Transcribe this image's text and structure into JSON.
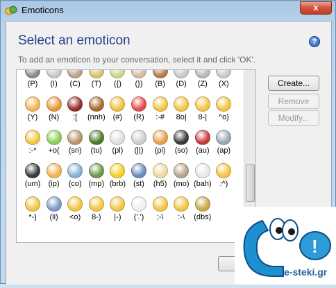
{
  "window": {
    "title": "Emoticons",
    "close_label": "x"
  },
  "dialog": {
    "heading": "Select an emoticon",
    "subtitle": "To add an emoticon to your conversation, select it and click 'OK'.",
    "help_label": "?"
  },
  "buttons": {
    "create": "Create...",
    "remove": "Remove",
    "modify": "Modify..."
  },
  "emoticons": {
    "row0": [
      "(P)",
      "(I)",
      "(C)",
      "(T)",
      "({)",
      "(})",
      "(B)",
      "(D)",
      "(Z)",
      "(X)"
    ],
    "row1": [
      "(Y)",
      "(N)",
      ":[",
      "(nnh)",
      "(#)",
      "(R)",
      ":-#",
      "8o|",
      "8-|",
      "^o)"
    ],
    "row2": [
      ":-*",
      "+o(",
      "(sn)",
      "(tu)",
      "(pl)",
      "(||)",
      "(pi)",
      "(so)",
      "(au)",
      "(ap)"
    ],
    "row3": [
      "(um)",
      "(ip)",
      "(co)",
      "(mp)",
      "(brb)",
      "(st)",
      "(h5)",
      "(mo)",
      "(bah)",
      ":^)"
    ],
    "row4": [
      "*-)",
      "(li)",
      "<o)",
      "8-)",
      "|-)",
      "('.')",
      ";-\\",
      ":-\\",
      "(dbs)"
    ]
  },
  "icon_colors": {
    "row0": [
      "#8a8a8a",
      "#c9c9c9",
      "#b9a38a",
      "#d9c46a",
      "#c9d98a",
      "#d9b9a0",
      "#b97a4a",
      "#c9c9c9",
      "#b9b9b9",
      "#c9c9c9"
    ],
    "row1": [
      "#f2b552",
      "#e89a3a",
      "#9a2a2a",
      "#a86a2a",
      "#f2c23a",
      "#e84a4a",
      "#f5c542",
      "#f5c542",
      "#f5c542",
      "#f5c542"
    ],
    "row2": [
      "#f5c542",
      "#8ccf5a",
      "#b9946a",
      "#4a7a2a",
      "#e0e0e0",
      "#cfcfcf",
      "#e8a04a",
      "#3a3a3a",
      "#c83a3a",
      "#9aa8b8"
    ],
    "row3": [
      "#3a3a3a",
      "#f2b552",
      "#8ab0d8",
      "#6a9a4a",
      "#f5d020",
      "#6a8abf",
      "#f2d9a0",
      "#b9a38a",
      "#e8e8e8",
      "#f5c542"
    ],
    "row4": [
      "#f5c542",
      "#7a9ac8",
      "#f5c542",
      "#f5c542",
      "#f5c542",
      "#f0f0f0",
      "#f5c542",
      "#f5c542",
      "#c8a848"
    ]
  },
  "icons": {
    "title": "emoticons-app-icon",
    "help": "help-icon",
    "logo": "e-steki-mascot-icon"
  },
  "logo": {
    "text": "e-steki.gr"
  }
}
